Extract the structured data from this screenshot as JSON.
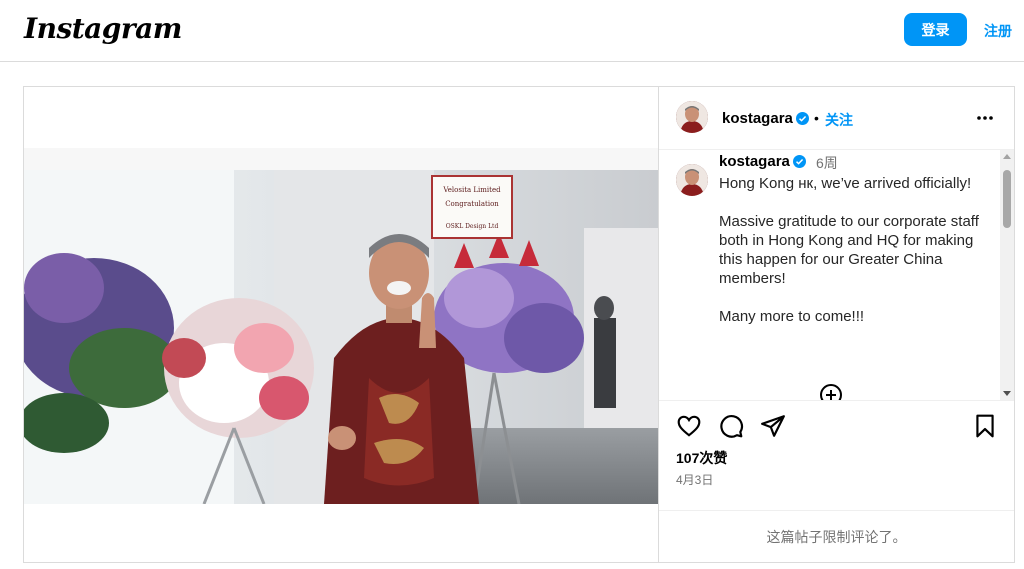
{
  "header": {
    "logo_text": "Instagram",
    "login_label": "登录",
    "signup_label": "注册"
  },
  "post": {
    "username": "kostagara",
    "follow_label": "关注",
    "dot": "•",
    "caption": "Hong Kong нк, we’ve arrived officially!\n\nMassive gratitude to our corporate staff both in Hong Kong and HQ for making this happen for our Greater China members!\n\nMany more to come!!!",
    "time_ago": "6周",
    "likes": "107次赞",
    "date": "4月3日",
    "comments_limited": "这篇帖子限制评论了。",
    "photo_sign": {
      "line1": "Velosita Limited",
      "line2": "Congratulation",
      "line3": "OSKL Design Ltd"
    }
  },
  "icons": {
    "more": "more-horizontal-icon",
    "like": "heart-icon",
    "comment": "comment-icon",
    "share": "share-icon",
    "save": "bookmark-icon",
    "mute": "muted-speaker-icon",
    "verified": "verified-badge-icon",
    "add": "add-circle-icon"
  },
  "colors": {
    "accent": "#0095f6",
    "muted_text": "#737373",
    "border": "#dbdbdb"
  }
}
